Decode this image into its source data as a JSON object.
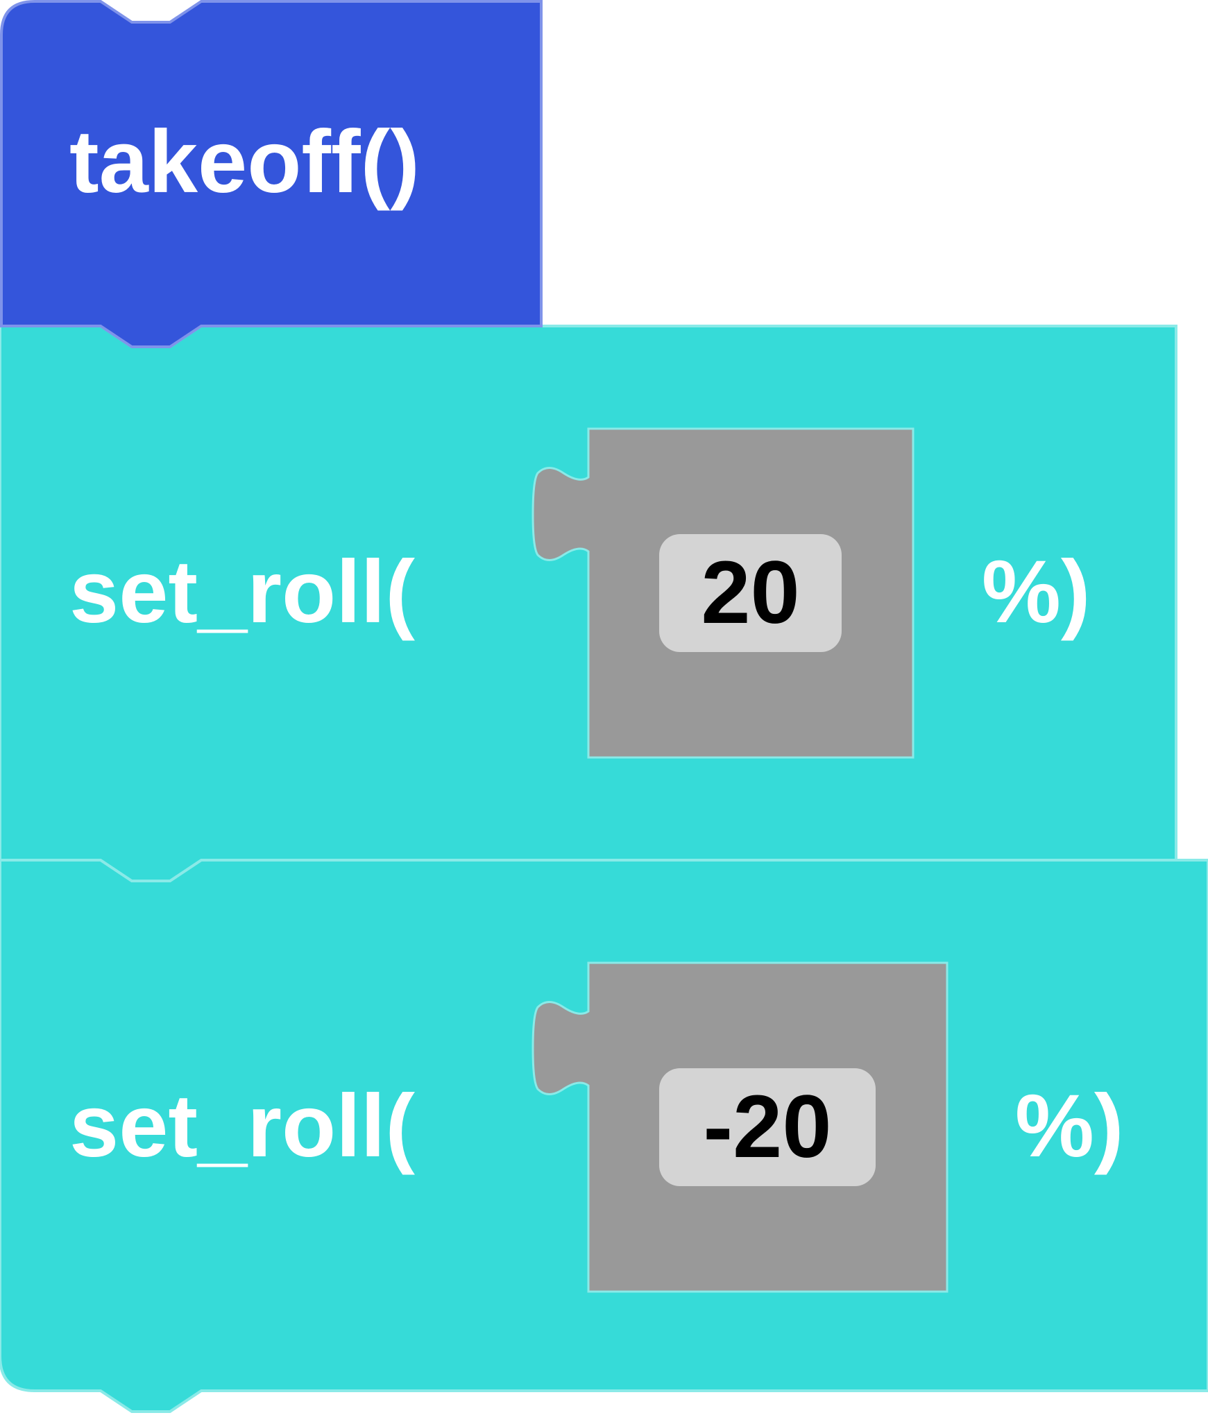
{
  "colors": {
    "takeoff_block": "#3455db",
    "takeoff_border": "#7f93ea",
    "roll_block": "#36dbd8",
    "roll_border": "#8aeae8",
    "number_block": "#999999",
    "value_pill": "#d4d4d4"
  },
  "blocks": [
    {
      "type": "takeoff",
      "label": "takeoff()"
    },
    {
      "type": "set_roll",
      "prefix": "set_roll(",
      "value": "20",
      "suffix": "%)"
    },
    {
      "type": "set_roll",
      "prefix": "set_roll(",
      "value": "-20",
      "suffix": "%)"
    }
  ]
}
